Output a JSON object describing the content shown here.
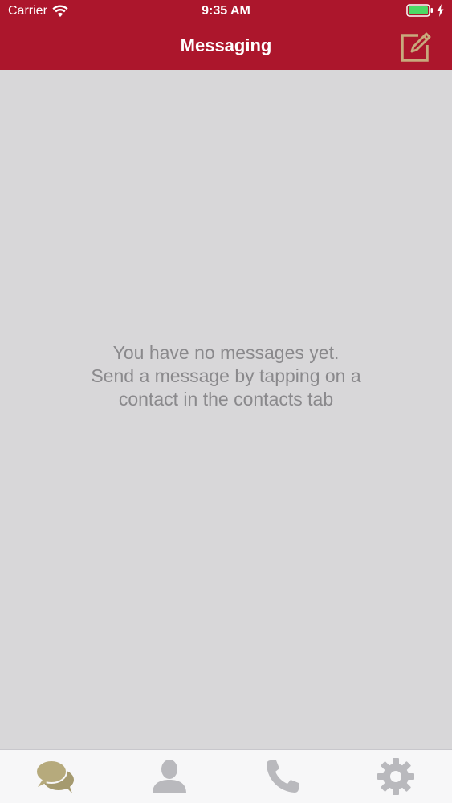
{
  "status_bar": {
    "carrier": "Carrier",
    "time": "9:35 AM"
  },
  "nav": {
    "title": "Messaging",
    "compose_icon": "compose-icon"
  },
  "empty_state": {
    "line1": "You have no messages yet.",
    "line2": "Send a message by tapping on a",
    "line3": "contact in the contacts tab"
  },
  "tabs": [
    {
      "icon": "chat-bubbles-icon",
      "active": true
    },
    {
      "icon": "person-icon",
      "active": false
    },
    {
      "icon": "phone-icon",
      "active": false
    },
    {
      "icon": "gear-icon",
      "active": false
    }
  ],
  "colors": {
    "brand_red": "#ac162c",
    "active_tab": "#a59a6f",
    "inactive_tab": "#b9b9bd",
    "compose_icon": "#c8a97c",
    "empty_text": "#8a898c",
    "background": "#d8d7d9"
  }
}
